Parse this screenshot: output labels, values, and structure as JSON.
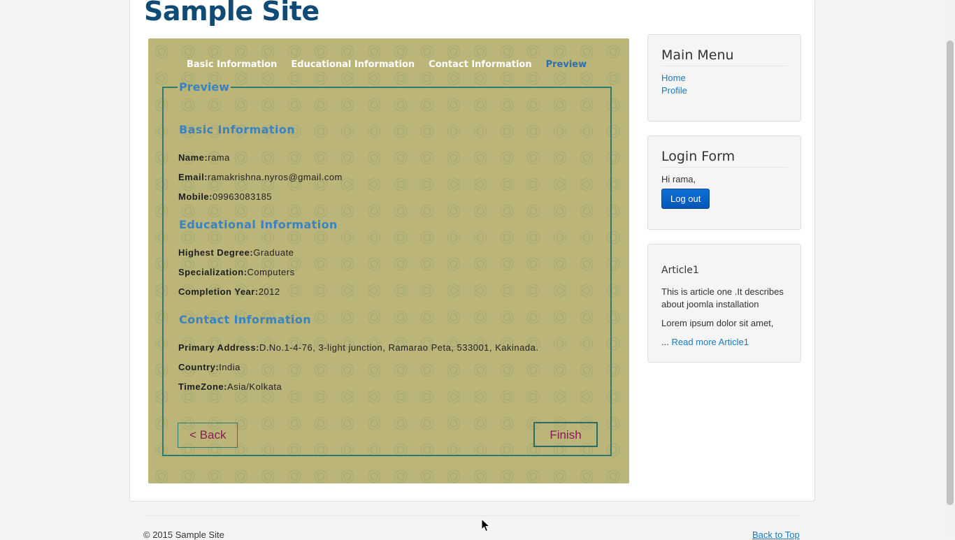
{
  "site": {
    "title": "Sample Site"
  },
  "wizard": {
    "steps": [
      "Basic Information",
      "Educational Information",
      "Contact Information",
      "Preview"
    ],
    "active_step": "Preview",
    "legend": "Preview",
    "sections": {
      "basic": {
        "heading": "Basic Information",
        "fields": [
          {
            "label": "Name:",
            "value": "rama"
          },
          {
            "label": "Email:",
            "value": "ramakrishna.nyros@gmail.com"
          },
          {
            "label": "Mobile:",
            "value": "09963083185"
          }
        ]
      },
      "education": {
        "heading": "Educational Information",
        "fields": [
          {
            "label": "Highest Degree:",
            "value": "Graduate"
          },
          {
            "label": "Specialization:",
            "value": "Computers"
          },
          {
            "label": "Completion Year:",
            "value": "2012"
          }
        ]
      },
      "contact": {
        "heading": "Contact Information",
        "fields": [
          {
            "label": "Primary Address:",
            "value": "D.No.1-4-76, 3-light junction, Ramarao Peta, 533001, Kakinada."
          },
          {
            "label": "Country:",
            "value": "India"
          },
          {
            "label": "TimeZone:",
            "value": "Asia/Kolkata"
          }
        ]
      }
    },
    "back_label": "< Back",
    "finish_label": "Finish"
  },
  "sidebar": {
    "main_menu": {
      "title": "Main Menu",
      "items": [
        "Home",
        "Profile"
      ]
    },
    "login": {
      "title": "Login Form",
      "greeting": "Hi rama,",
      "logout_label": "Log out"
    },
    "article": {
      "title": "Article1",
      "text": "This is article one .It describes about joomla installation",
      "excerpt": "Lorem ipsum dolor sit amet,",
      "ellipsis": "...",
      "read_more": "Read more Article1"
    }
  },
  "footer": {
    "copyright": "© 2015 Sample Site",
    "back_to_top": "Back to Top"
  }
}
